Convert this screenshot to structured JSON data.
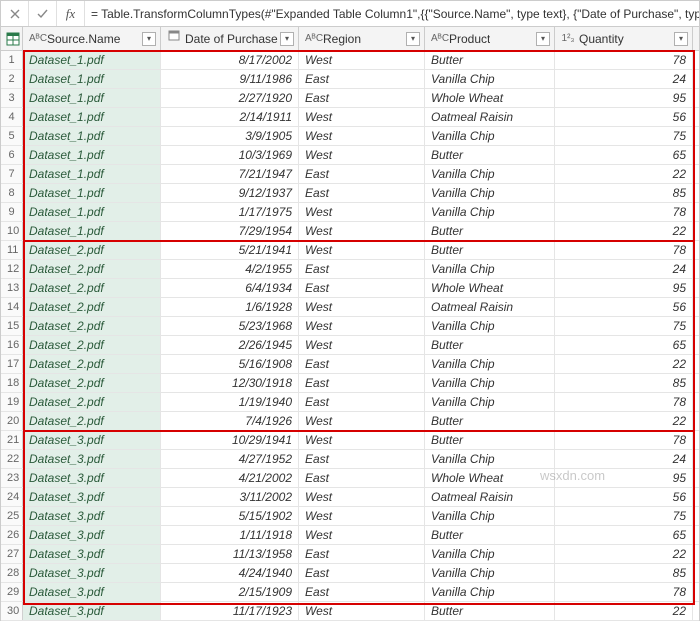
{
  "formula": "= Table.TransformColumnTypes(#\"Expanded Table Column1\",{{\"Source.Name\", type text}, {\"Date of Purchase\", type",
  "columns": {
    "source": {
      "label": "Source.Name",
      "type_icon": "AᴮC"
    },
    "date": {
      "label": "Date of Purchase",
      "type_icon": "📅"
    },
    "region": {
      "label": "Region",
      "type_icon": "AᴮC"
    },
    "product": {
      "label": "Product",
      "type_icon": "AᴮC"
    },
    "qty": {
      "label": "Quantity",
      "type_icon": "1²₃"
    }
  },
  "rows": [
    {
      "n": 1,
      "src": "Dataset_1.pdf",
      "date": "8/17/2002",
      "reg": "West",
      "prod": "Butter",
      "qty": 78
    },
    {
      "n": 2,
      "src": "Dataset_1.pdf",
      "date": "9/11/1986",
      "reg": "East",
      "prod": "Vanilla Chip",
      "qty": 24
    },
    {
      "n": 3,
      "src": "Dataset_1.pdf",
      "date": "2/27/1920",
      "reg": "East",
      "prod": "Whole Wheat",
      "qty": 95
    },
    {
      "n": 4,
      "src": "Dataset_1.pdf",
      "date": "2/14/1911",
      "reg": "West",
      "prod": "Oatmeal Raisin",
      "qty": 56
    },
    {
      "n": 5,
      "src": "Dataset_1.pdf",
      "date": "3/9/1905",
      "reg": "West",
      "prod": "Vanilla Chip",
      "qty": 75
    },
    {
      "n": 6,
      "src": "Dataset_1.pdf",
      "date": "10/3/1969",
      "reg": "West",
      "prod": "Butter",
      "qty": 65
    },
    {
      "n": 7,
      "src": "Dataset_1.pdf",
      "date": "7/21/1947",
      "reg": "East",
      "prod": "Vanilla Chip",
      "qty": 22
    },
    {
      "n": 8,
      "src": "Dataset_1.pdf",
      "date": "9/12/1937",
      "reg": "East",
      "prod": "Vanilla Chip",
      "qty": 85
    },
    {
      "n": 9,
      "src": "Dataset_1.pdf",
      "date": "1/17/1975",
      "reg": "West",
      "prod": "Vanilla Chip",
      "qty": 78
    },
    {
      "n": 10,
      "src": "Dataset_1.pdf",
      "date": "7/29/1954",
      "reg": "West",
      "prod": "Butter",
      "qty": 22
    },
    {
      "n": 11,
      "src": "Dataset_2.pdf",
      "date": "5/21/1941",
      "reg": "West",
      "prod": "Butter",
      "qty": 78
    },
    {
      "n": 12,
      "src": "Dataset_2.pdf",
      "date": "4/2/1955",
      "reg": "East",
      "prod": "Vanilla Chip",
      "qty": 24
    },
    {
      "n": 13,
      "src": "Dataset_2.pdf",
      "date": "6/4/1934",
      "reg": "East",
      "prod": "Whole Wheat",
      "qty": 95
    },
    {
      "n": 14,
      "src": "Dataset_2.pdf",
      "date": "1/6/1928",
      "reg": "West",
      "prod": "Oatmeal Raisin",
      "qty": 56
    },
    {
      "n": 15,
      "src": "Dataset_2.pdf",
      "date": "5/23/1968",
      "reg": "West",
      "prod": "Vanilla Chip",
      "qty": 75
    },
    {
      "n": 16,
      "src": "Dataset_2.pdf",
      "date": "2/26/1945",
      "reg": "West",
      "prod": "Butter",
      "qty": 65
    },
    {
      "n": 17,
      "src": "Dataset_2.pdf",
      "date": "5/16/1908",
      "reg": "East",
      "prod": "Vanilla Chip",
      "qty": 22
    },
    {
      "n": 18,
      "src": "Dataset_2.pdf",
      "date": "12/30/1918",
      "reg": "East",
      "prod": "Vanilla Chip",
      "qty": 85
    },
    {
      "n": 19,
      "src": "Dataset_2.pdf",
      "date": "1/19/1940",
      "reg": "East",
      "prod": "Vanilla Chip",
      "qty": 78
    },
    {
      "n": 20,
      "src": "Dataset_2.pdf",
      "date": "7/4/1926",
      "reg": "West",
      "prod": "Butter",
      "qty": 22
    },
    {
      "n": 21,
      "src": "Dataset_3.pdf",
      "date": "10/29/1941",
      "reg": "West",
      "prod": "Butter",
      "qty": 78
    },
    {
      "n": 22,
      "src": "Dataset_3.pdf",
      "date": "4/27/1952",
      "reg": "East",
      "prod": "Vanilla Chip",
      "qty": 24
    },
    {
      "n": 23,
      "src": "Dataset_3.pdf",
      "date": "4/21/2002",
      "reg": "East",
      "prod": "Whole Wheat",
      "qty": 95
    },
    {
      "n": 24,
      "src": "Dataset_3.pdf",
      "date": "3/11/2002",
      "reg": "West",
      "prod": "Oatmeal Raisin",
      "qty": 56
    },
    {
      "n": 25,
      "src": "Dataset_3.pdf",
      "date": "5/15/1902",
      "reg": "West",
      "prod": "Vanilla Chip",
      "qty": 75
    },
    {
      "n": 26,
      "src": "Dataset_3.pdf",
      "date": "1/11/1918",
      "reg": "West",
      "prod": "Butter",
      "qty": 65
    },
    {
      "n": 27,
      "src": "Dataset_3.pdf",
      "date": "11/13/1958",
      "reg": "East",
      "prod": "Vanilla Chip",
      "qty": 22
    },
    {
      "n": 28,
      "src": "Dataset_3.pdf",
      "date": "4/24/1940",
      "reg": "East",
      "prod": "Vanilla Chip",
      "qty": 85
    },
    {
      "n": 29,
      "src": "Dataset_3.pdf",
      "date": "2/15/1909",
      "reg": "East",
      "prod": "Vanilla Chip",
      "qty": 78
    },
    {
      "n": 30,
      "src": "Dataset_3.pdf",
      "date": "11/17/1923",
      "reg": "West",
      "prod": "Butter",
      "qty": 22
    }
  ],
  "watermark": "wsxdn.com"
}
